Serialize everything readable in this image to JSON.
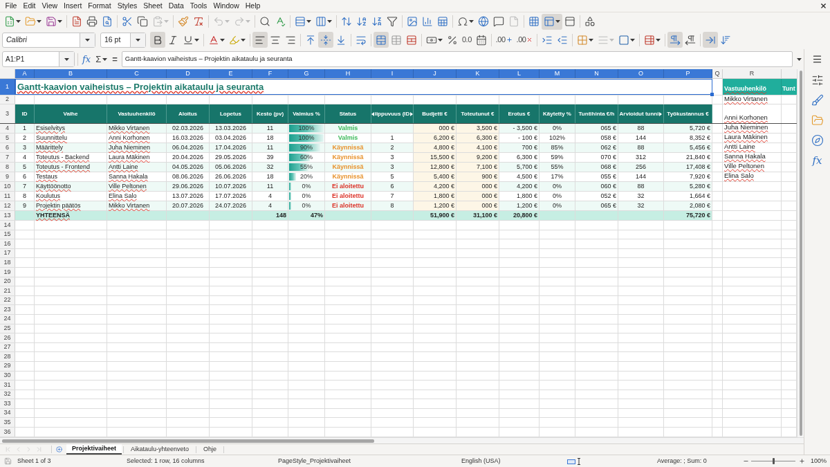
{
  "menu": {
    "items": [
      "File",
      "Edit",
      "View",
      "Insert",
      "Format",
      "Styles",
      "Sheet",
      "Data",
      "Tools",
      "Window",
      "Help"
    ]
  },
  "standard_toolbar": [
    [
      {
        "active": false,
        "disabled": false,
        "dropdown": true
      },
      {
        "active": false,
        "disabled": false,
        "dropdown": true
      },
      {
        "active": false,
        "disabled": false,
        "dropdown": true
      }
    ],
    [
      {
        "active": false,
        "disabled": false,
        "dropdown": false
      },
      {
        "active": false,
        "disabled": false,
        "dropdown": false
      },
      {
        "active": false,
        "disabled": false,
        "dropdown": false
      }
    ],
    [
      {
        "active": false,
        "disabled": false,
        "dropdown": false
      },
      {
        "active": false,
        "disabled": false,
        "dropdown": false
      },
      {
        "active": false,
        "disabled": true,
        "dropdown": true
      }
    ],
    [
      {
        "active": false,
        "disabled": false,
        "dropdown": false
      },
      {
        "active": false,
        "disabled": false,
        "dropdown": false
      }
    ],
    [
      {
        "active": false,
        "disabled": true,
        "dropdown": true
      },
      {
        "active": false,
        "disabled": true,
        "dropdown": true
      }
    ],
    [
      {
        "active": false,
        "disabled": false,
        "dropdown": false
      },
      {
        "active": false,
        "disabled": false,
        "dropdown": false
      }
    ],
    [
      {
        "active": false,
        "disabled": false,
        "dropdown": true
      },
      {
        "active": false,
        "disabled": false,
        "dropdown": true
      }
    ],
    [
      {
        "active": false,
        "disabled": false,
        "dropdown": false
      },
      {
        "active": false,
        "disabled": false,
        "dropdown": false
      },
      {
        "active": false,
        "disabled": false,
        "dropdown": false
      },
      {
        "active": false,
        "disabled": false,
        "dropdown": false
      }
    ],
    [
      {
        "active": false,
        "disabled": false,
        "dropdown": false
      },
      {
        "active": false,
        "disabled": false,
        "dropdown": false
      },
      {
        "active": false,
        "disabled": false,
        "dropdown": false
      }
    ],
    [
      {
        "active": false,
        "disabled": false,
        "dropdown": true
      },
      {
        "active": false,
        "disabled": false,
        "dropdown": false
      },
      {
        "active": false,
        "disabled": false,
        "dropdown": false
      },
      {
        "active": false,
        "disabled": true,
        "dropdown": false
      }
    ],
    [
      {
        "active": false,
        "disabled": false,
        "dropdown": false
      },
      {
        "active": true,
        "disabled": false,
        "dropdown": true
      },
      {
        "active": false,
        "disabled": false,
        "dropdown": false
      }
    ],
    [
      {
        "active": false,
        "disabled": false,
        "dropdown": false
      }
    ]
  ],
  "format_toolbar": {
    "font_name": "Calibri",
    "font_size": "16 pt",
    "groups": [
      [
        {
          "active": true,
          "disabled": false,
          "dropdown": false
        },
        {
          "active": false,
          "disabled": false,
          "dropdown": false
        },
        {
          "active": false,
          "disabled": false,
          "dropdown": true
        }
      ],
      [
        {
          "active": false,
          "disabled": false,
          "dropdown": true
        },
        {
          "active": false,
          "disabled": false,
          "dropdown": true
        }
      ],
      [
        {
          "active": true,
          "disabled": false,
          "dropdown": false
        },
        {
          "active": false,
          "disabled": false,
          "dropdown": false
        },
        {
          "active": false,
          "disabled": false,
          "dropdown": false
        }
      ],
      [
        {
          "active": false,
          "disabled": false,
          "dropdown": false
        },
        {
          "active": true,
          "disabled": false,
          "dropdown": false
        },
        {
          "active": false,
          "disabled": false,
          "dropdown": false
        }
      ],
      [
        {
          "active": false,
          "disabled": false,
          "dropdown": false
        }
      ],
      [
        {
          "active": true,
          "disabled": false,
          "dropdown": false
        },
        {
          "active": false,
          "disabled": false,
          "dropdown": false
        },
        {
          "active": false,
          "disabled": false,
          "dropdown": false
        }
      ],
      [
        {
          "active": false,
          "disabled": false,
          "dropdown": true
        },
        {
          "active": false,
          "disabled": false,
          "dropdown": false
        },
        {
          "glyph": "0.0",
          "active": false,
          "disabled": false,
          "dropdown": false
        },
        {
          "active": false,
          "disabled": false,
          "dropdown": false
        }
      ],
      [
        {
          "glyph": ".00",
          "active": false,
          "disabled": false,
          "dropdown": false
        },
        {
          "glyph": ".00",
          "active": false,
          "disabled": false,
          "dropdown": false
        }
      ],
      [
        {
          "active": false,
          "disabled": false,
          "dropdown": false
        },
        {
          "active": false,
          "disabled": false,
          "dropdown": false
        }
      ],
      [
        {
          "active": false,
          "disabled": false,
          "dropdown": true
        },
        {
          "active": false,
          "disabled": true,
          "dropdown": true
        },
        {
          "active": false,
          "disabled": false,
          "dropdown": true
        }
      ],
      [
        {
          "active": false,
          "disabled": false,
          "dropdown": true
        }
      ],
      [
        {
          "active": true,
          "disabled": false,
          "dropdown": false
        },
        {
          "active": false,
          "disabled": false,
          "dropdown": false
        }
      ],
      [
        {
          "active": true,
          "disabled": false,
          "dropdown": false
        },
        {
          "active": false,
          "disabled": false,
          "dropdown": false
        }
      ]
    ]
  },
  "formula_bar": {
    "name_box": "A1:P1",
    "wizard": "fx",
    "sum": "Σ",
    "equals": "=",
    "content": "Gantt-kaavion vaiheistus – Projektin aikataulu ja seuranta"
  },
  "grid": {
    "autospell": true,
    "columns": [
      {
        "letter": "A",
        "selected": true
      },
      {
        "letter": "B",
        "selected": true
      },
      {
        "letter": "C",
        "selected": true
      },
      {
        "letter": "D",
        "selected": true
      },
      {
        "letter": "E",
        "selected": true
      },
      {
        "letter": "F",
        "selected": true
      },
      {
        "letter": "G",
        "selected": true
      },
      {
        "letter": "H",
        "selected": true
      },
      {
        "letter": "I",
        "selected": true
      },
      {
        "letter": "J",
        "selected": true
      },
      {
        "letter": "K",
        "selected": true
      },
      {
        "letter": "L",
        "selected": true
      },
      {
        "letter": "M",
        "selected": true
      },
      {
        "letter": "N",
        "selected": true
      },
      {
        "letter": "O",
        "selected": true
      },
      {
        "letter": "P",
        "selected": true
      },
      {
        "letter": "Q",
        "selected": false
      },
      {
        "letter": "R",
        "selected": false
      }
    ],
    "row_headers": [
      {
        "label": "1",
        "selected": true
      },
      {
        "label": "2",
        "selected": false
      },
      {
        "label": "3",
        "selected": false
      },
      {
        "label": "4",
        "selected": false
      },
      {
        "label": "5",
        "selected": false
      },
      {
        "label": "6",
        "selected": false
      },
      {
        "label": "7",
        "selected": false
      },
      {
        "label": "8",
        "selected": false
      },
      {
        "label": "9",
        "selected": false
      },
      {
        "label": "10",
        "selected": false
      },
      {
        "label": "11",
        "selected": false
      },
      {
        "label": "12",
        "selected": false
      },
      {
        "label": "13",
        "selected": false
      },
      {
        "label": "14",
        "selected": false
      },
      {
        "label": "15",
        "selected": false
      },
      {
        "label": "16",
        "selected": false
      },
      {
        "label": "17",
        "selected": false
      },
      {
        "label": "18",
        "selected": false
      },
      {
        "label": "19",
        "selected": false
      },
      {
        "label": "20",
        "selected": false
      },
      {
        "label": "21",
        "selected": false
      },
      {
        "label": "22",
        "selected": false
      },
      {
        "label": "23",
        "selected": false
      },
      {
        "label": "24",
        "selected": false
      },
      {
        "label": "25",
        "selected": false
      },
      {
        "label": "26",
        "selected": false
      },
      {
        "label": "27",
        "selected": false
      },
      {
        "label": "28",
        "selected": false
      },
      {
        "label": "29",
        "selected": false
      },
      {
        "label": "30",
        "selected": false
      },
      {
        "label": "31",
        "selected": false
      },
      {
        "label": "32",
        "selected": false
      },
      {
        "label": "33",
        "selected": false
      },
      {
        "label": "34",
        "selected": false
      },
      {
        "label": "35",
        "selected": false
      },
      {
        "label": "36",
        "selected": false
      }
    ],
    "title": {
      "text": "Gantt-kaavion vaiheistus – Projektin aikataulu ja seuranta",
      "selected": true
    },
    "headers": [
      {
        "label": "ID",
        "overflow_left": false,
        "overflow_right": false
      },
      {
        "label": "Vaihe",
        "overflow_left": false,
        "overflow_right": false
      },
      {
        "label": "Vastuuhenkilö",
        "overflow_left": false,
        "overflow_right": false
      },
      {
        "label": "Aloitus",
        "overflow_left": false,
        "overflow_right": false
      },
      {
        "label": "Lopetus",
        "overflow_left": false,
        "overflow_right": false
      },
      {
        "label": "Kesto (pv)",
        "overflow_left": false,
        "overflow_right": false
      },
      {
        "label": "Valmius %",
        "overflow_left": false,
        "overflow_right": false
      },
      {
        "label": "Status",
        "overflow_left": false,
        "overflow_right": false
      },
      {
        "label": "iippuvuus (ID",
        "overflow_left": true,
        "overflow_right": true
      },
      {
        "label": "Budjetti €",
        "overflow_left": false,
        "overflow_right": false
      },
      {
        "label": "Toteutunut €",
        "overflow_left": false,
        "overflow_right": false
      },
      {
        "label": "Erotus €",
        "overflow_left": false,
        "overflow_right": false
      },
      {
        "label": "Käytetty %",
        "overflow_left": false,
        "overflow_right": false
      },
      {
        "label": "Tuntihinta €/h",
        "overflow_left": false,
        "overflow_right": false
      },
      {
        "label": "Arvioidut tunni",
        "overflow_left": false,
        "overflow_right": true
      },
      {
        "label": "Työkustannus €",
        "overflow_left": false,
        "overflow_right": false
      }
    ],
    "rows": [
      {
        "id": "1",
        "phase": "Esiselvitys",
        "owner": "Mikko Virtanen",
        "start": "02.03.2026",
        "end": "13.03.2026",
        "duration": "11",
        "progress": {
          "text": "100%",
          "level": 1
        },
        "status": {
          "text": "Valmis",
          "color": "#3cb95a"
        },
        "budget": "000 €",
        "actual": "3,500 €",
        "difference": "- 3,500 €",
        "used": "0%",
        "rate": "065 €",
        "hours": "88",
        "labor_cost": "5,720 €"
      },
      {
        "id": "2",
        "phase": "Suunnittelu",
        "owner": "Anni Korhonen",
        "start": "16.03.2026",
        "end": "03.04.2026",
        "duration": "18",
        "progress": {
          "text": "100%",
          "level": 1
        },
        "status": {
          "text": "Valmis",
          "color": "#3cb95a"
        },
        "dependency": "1",
        "budget": "6,200 €",
        "actual": "6,300 €",
        "difference": "- 100 €",
        "used": "102%",
        "rate": "058 €",
        "hours": "144",
        "labor_cost": "8,352 €"
      },
      {
        "id": "3",
        "phase": "Määrittely",
        "owner": "Juha Nieminen",
        "start": "06.04.2026",
        "end": "17.04.2026",
        "duration": "11",
        "progress": {
          "text": "90%",
          "level": 0.9
        },
        "status": {
          "text": "Käynnissä",
          "color": "#e8922c"
        },
        "dependency": "2",
        "budget": "4,800 €",
        "actual": "4,100 €",
        "difference": "700 €",
        "used": "85%",
        "rate": "062 €",
        "hours": "88",
        "labor_cost": "5,456 €"
      },
      {
        "id": "4",
        "phase": "Toteutus - Backend",
        "owner": "Laura Mäkinen",
        "start": "20.04.2026",
        "end": "29.05.2026",
        "duration": "39",
        "progress": {
          "text": "60%",
          "level": 0.6
        },
        "status": {
          "text": "Käynnissä",
          "color": "#e8922c"
        },
        "dependency": "3",
        "budget": "15,500 €",
        "actual": "9,200 €",
        "difference": "6,300 €",
        "used": "59%",
        "rate": "070 €",
        "hours": "312",
        "labor_cost": "21,840 €"
      },
      {
        "id": "5",
        "phase": "Toteutus - Frontend",
        "owner": "Antti Laine",
        "start": "04.05.2026",
        "end": "05.06.2026",
        "duration": "32",
        "progress": {
          "text": "55%",
          "level": 0.55
        },
        "status": {
          "text": "Käynnissä",
          "color": "#e8922c"
        },
        "dependency": "3",
        "budget": "12,800 €",
        "actual": "7,100 €",
        "difference": "5,700 €",
        "used": "55%",
        "rate": "068 €",
        "hours": "256",
        "labor_cost": "17,408 €"
      },
      {
        "id": "6",
        "phase": "Testaus",
        "owner": "Sanna Hakala",
        "start": "08.06.2026",
        "end": "26.06.2026",
        "duration": "18",
        "progress": {
          "text": "20%",
          "level": 0.2
        },
        "status": {
          "text": "Käynnissä",
          "color": "#e8922c"
        },
        "dependency": "5",
        "budget": "5,400 €",
        "actual": "900 €",
        "difference": "4,500 €",
        "used": "17%",
        "rate": "055 €",
        "hours": "144",
        "labor_cost": "7,920 €"
      },
      {
        "id": "7",
        "phase": "Käyttöönotto",
        "owner": "Ville Peltonen",
        "start": "29.06.2026",
        "end": "10.07.2026",
        "duration": "11",
        "progress": {
          "text": "0%",
          "level": 0
        },
        "status": {
          "text": "Ei aloitettu",
          "color": "#dc3228"
        },
        "dependency": "6",
        "budget": "4,200 €",
        "actual": "000 €",
        "difference": "4,200 €",
        "used": "0%",
        "rate": "060 €",
        "hours": "88",
        "labor_cost": "5,280 €"
      },
      {
        "id": "8",
        "phase": "Koulutus",
        "owner": "Elina Salo",
        "start": "13.07.2026",
        "end": "17.07.2026",
        "duration": "4",
        "progress": {
          "text": "0%",
          "level": 0
        },
        "status": {
          "text": "Ei aloitettu",
          "color": "#dc3228"
        },
        "dependency": "7",
        "budget": "1,800 €",
        "actual": "000 €",
        "difference": "1,800 €",
        "used": "0%",
        "rate": "052 €",
        "hours": "32",
        "labor_cost": "1,664 €"
      },
      {
        "id": "9",
        "phase": "Projektin päätös",
        "owner": "Mikko Virtanen",
        "start": "20.07.2026",
        "end": "24.07.2026",
        "duration": "4",
        "progress": {
          "text": "0%",
          "level": 0
        },
        "status": {
          "text": "Ei aloitettu",
          "color": "#dc3228"
        },
        "dependency": "8",
        "budget": "1,200 €",
        "actual": "000 €",
        "difference": "1,200 €",
        "used": "0%",
        "rate": "065 €",
        "hours": "32",
        "labor_cost": "2,080 €"
      }
    ],
    "total": {
      "label": "YHTEENSÄ",
      "duration": "148",
      "progress": "47%",
      "budget": "51,900 €",
      "actual": "31,100 €",
      "difference": "20,800 €",
      "labor_cost": "75,720 €"
    },
    "lookup": {
      "header": "Vastuuhenkilö",
      "header_next": "Tunt",
      "names": [
        "Mikko Virtanen",
        "Anni Korhonen",
        "Juha Nieminen",
        "Laura Mäkinen",
        "Antti Laine",
        "Sanna Hakala",
        "Ville Peltonen",
        "Elina Salo"
      ]
    }
  },
  "sheet_nav": {
    "disabled": true
  },
  "sheet_tabs": [
    {
      "label": "Projektivaiheet",
      "selected": true
    },
    {
      "label": "Aikataulu-yhteenveto",
      "selected": false
    },
    {
      "label": "Ohje",
      "selected": false
    }
  ],
  "sidebar": {
    "functions": "fx"
  },
  "status_bar": {
    "sheet": "Sheet 1 of 3",
    "selection": "Selected: 1 row, 16 columns",
    "page_style": "PageStyle_Projektivaiheet",
    "language": "English (USA)",
    "summary": "Average: ; Sum: 0",
    "zoom": {
      "level": 0.5,
      "reading": "100%"
    }
  }
}
